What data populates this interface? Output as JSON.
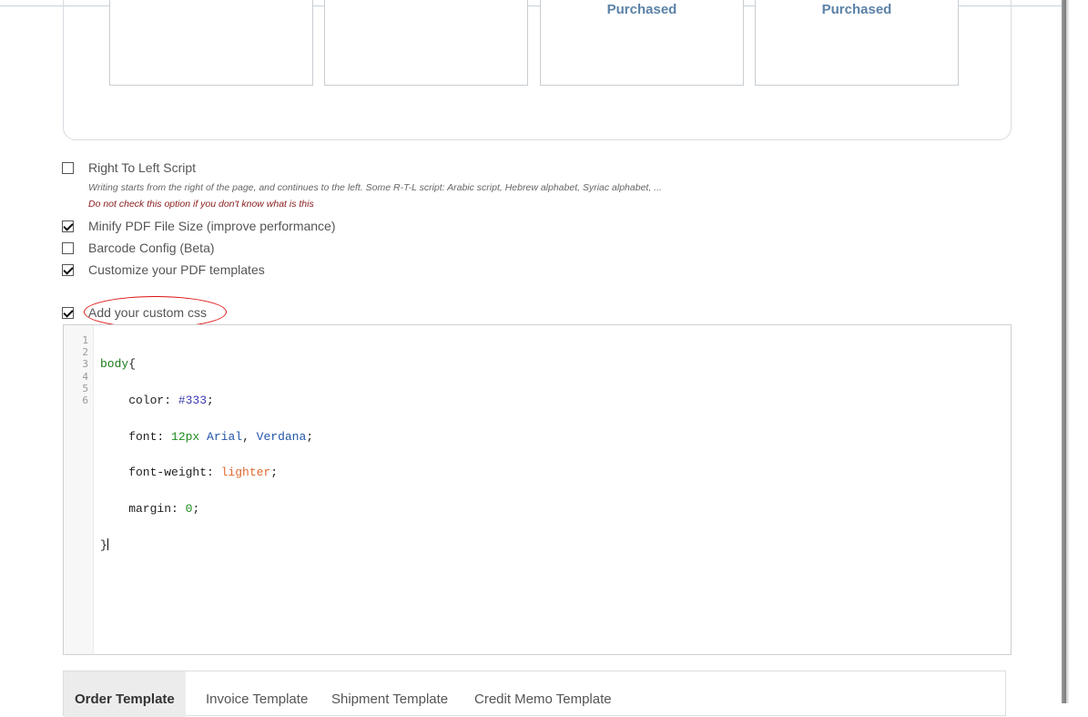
{
  "template_boxes": [
    {
      "status": ""
    },
    {
      "status": ""
    },
    {
      "status": "Purchased"
    },
    {
      "status": "Purchased"
    }
  ],
  "options": {
    "rtl": {
      "label": "Right To Left Script",
      "checked": false,
      "hint": "Writing starts from the right of the page, and continues to the left. Some R-T-L script: Arabic script, Hebrew alphabet, Syriac alphabet, ...",
      "warning": "Do not check this option if you don't know what is this"
    },
    "minify": {
      "label": "Minify PDF File Size (improve performance)",
      "checked": true
    },
    "barcode": {
      "label": "Barcode Config (Beta)",
      "checked": false
    },
    "customize": {
      "label": "Customize your PDF templates",
      "checked": true
    },
    "custom_css": {
      "label": "Add your custom css",
      "checked": true
    }
  },
  "editor": {
    "line_numbers": [
      "1",
      "2",
      "3",
      "4",
      "5",
      "6"
    ],
    "lines": [
      "body{",
      "    color: #333;",
      "    font: 12px Arial, Verdana;",
      "    font-weight: lighter;",
      "    margin: 0;",
      "}"
    ]
  },
  "tabs": [
    "Order Template",
    "Invoice Template",
    "Shipment Template",
    "Credit Memo Template"
  ],
  "colors": {
    "accent_blue": "#5b82a6",
    "annotation_red": "#d11111",
    "warning_text": "#8a1c1c"
  }
}
